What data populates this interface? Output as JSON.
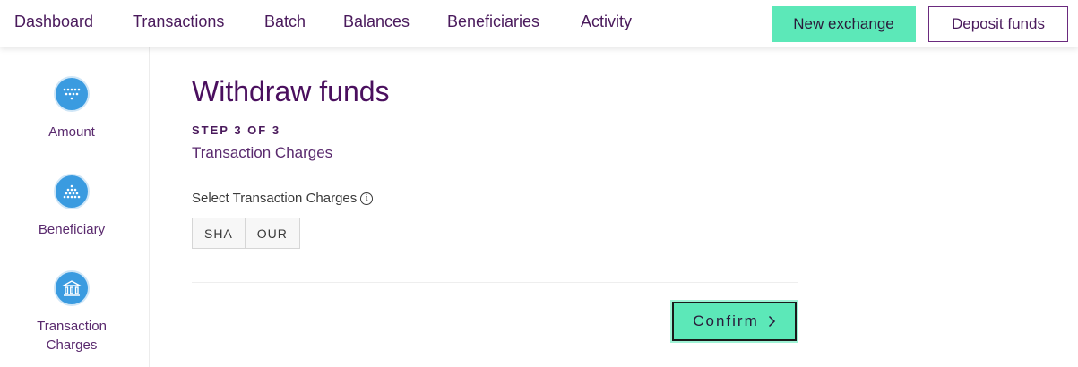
{
  "nav": {
    "items": [
      {
        "label": "Dashboard"
      },
      {
        "label": "Transactions"
      },
      {
        "label": "Batch"
      },
      {
        "label": "Balances"
      },
      {
        "label": "Beneficiaries"
      },
      {
        "label": "Activity"
      }
    ],
    "new_exchange_label": "New exchange",
    "deposit_label": "Deposit funds"
  },
  "steps": [
    {
      "label": "Amount",
      "icon": "keypad-icon"
    },
    {
      "label": "Beneficiary",
      "icon": "keypad-icon"
    },
    {
      "label": "Transaction Charges",
      "icon": "bank-icon"
    }
  ],
  "main": {
    "title": "Withdraw funds",
    "step_count": "STEP 3 OF 3",
    "subtitle": "Transaction Charges",
    "field_label": "Select Transaction Charges",
    "info_glyph": "i",
    "options": [
      "SHA",
      "OUR"
    ],
    "confirm_label": "Confirm"
  },
  "colors": {
    "accent": "#5ce8b8",
    "brand": "#4a1a5c",
    "step_icon": "#3a9be0"
  }
}
